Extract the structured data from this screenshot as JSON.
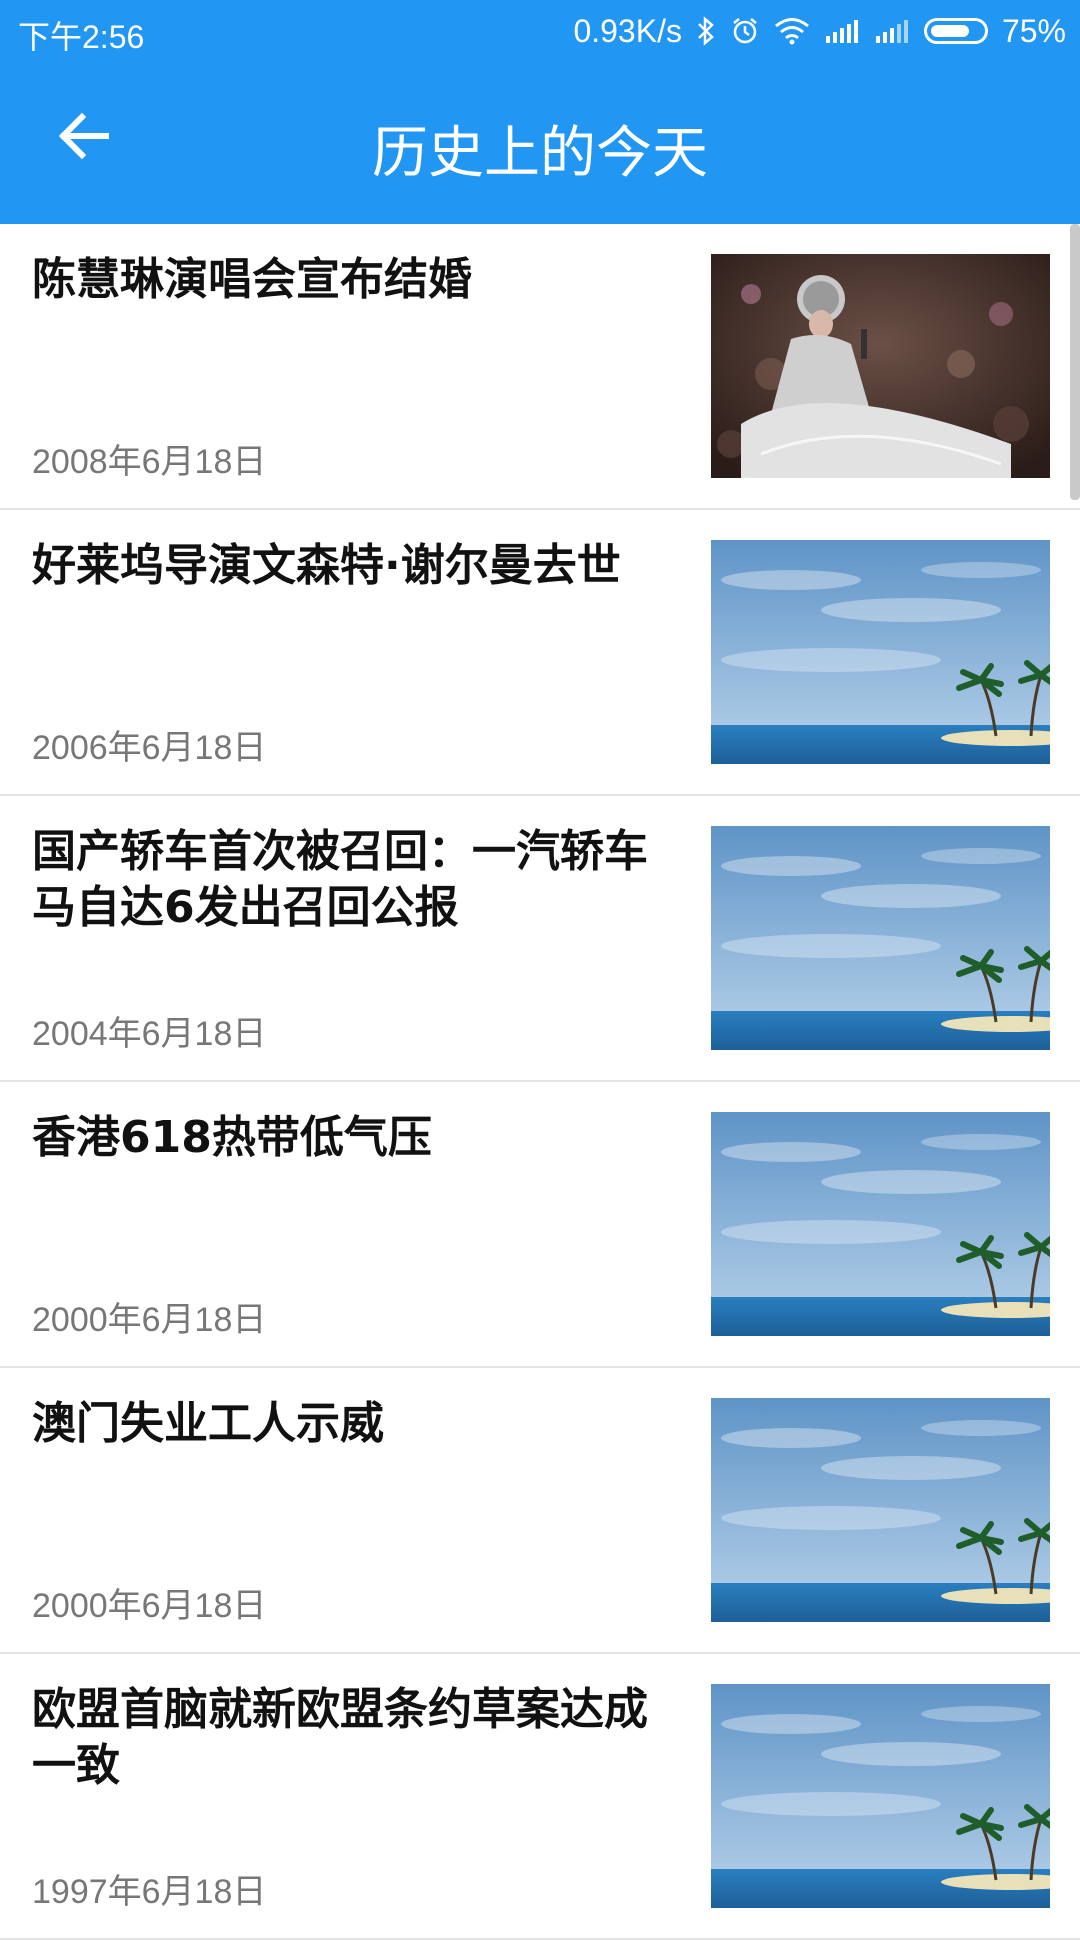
{
  "status_bar": {
    "time": "下午2:56",
    "speed": "0.93K/s",
    "battery": "75%",
    "battery_level": 0.75,
    "icons": [
      "bluetooth-icon",
      "alarm-icon",
      "wifi-icon",
      "signal-icon",
      "signal-icon",
      "battery-icon"
    ]
  },
  "toolbar": {
    "title": "历史上的今天",
    "back_icon": "arrow-left-icon"
  },
  "items": [
    {
      "title": "陈慧琳演唱会宣布结婚",
      "date": "2008年6月18日",
      "image": "concert-photo"
    },
    {
      "title": "好莱坞导演文森特·谢尔曼去世",
      "date": "2006年6月18日",
      "image": "beach-placeholder"
    },
    {
      "title": "国产轿车首次被召回：一汽轿车马自达6发出召回公报",
      "date": "2004年6月18日",
      "image": "beach-placeholder"
    },
    {
      "title": "香港618热带低气压",
      "date": "2000年6月18日",
      "image": "beach-placeholder"
    },
    {
      "title": "澳门失业工人示威",
      "date": "2000年6月18日",
      "image": "beach-placeholder"
    },
    {
      "title": "欧盟首脑就新欧盟条约草案达成一致",
      "date": "1997年6月18日",
      "image": "beach-placeholder"
    }
  ],
  "colors": {
    "primary": "#2196F3",
    "title_text": "#111111",
    "date_text": "#777777"
  }
}
